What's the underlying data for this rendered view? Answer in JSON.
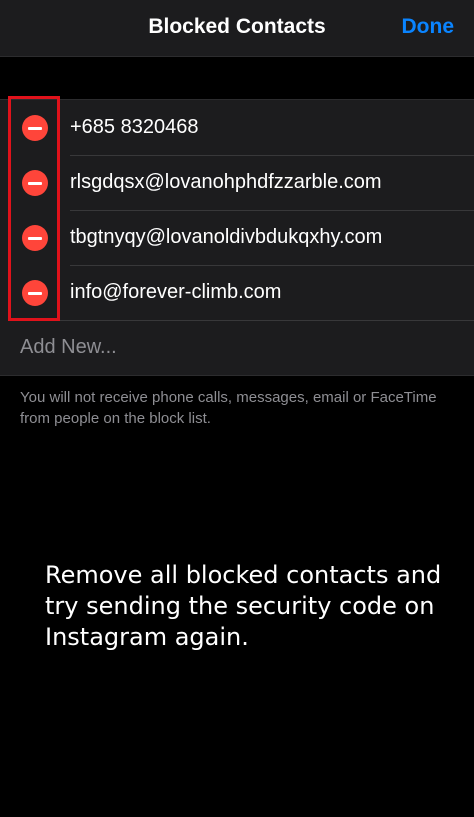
{
  "navbar": {
    "title": "Blocked Contacts",
    "done_label": "Done"
  },
  "blocked_list": {
    "items": [
      {
        "label": "+685 8320468"
      },
      {
        "label": "rlsgdqsx@lovanohphdfzzarble.com"
      },
      {
        "label": "tbgtnyqy@lovanoldivbdukqxhy.com"
      },
      {
        "label": "info@forever-climb.com"
      }
    ],
    "add_new_label": "Add New..."
  },
  "footer": {
    "note": "You will not receive phone calls, messages, email or FaceTime from people on the block list."
  },
  "overlay": {
    "caption": "Remove all blocked contacts and try sending the security code on Instagram again."
  },
  "colors": {
    "accent": "#0a84ff",
    "delete": "#ff453a",
    "highlight_box": "#e0121b"
  },
  "icons": {
    "delete": "minus-circle-icon"
  }
}
